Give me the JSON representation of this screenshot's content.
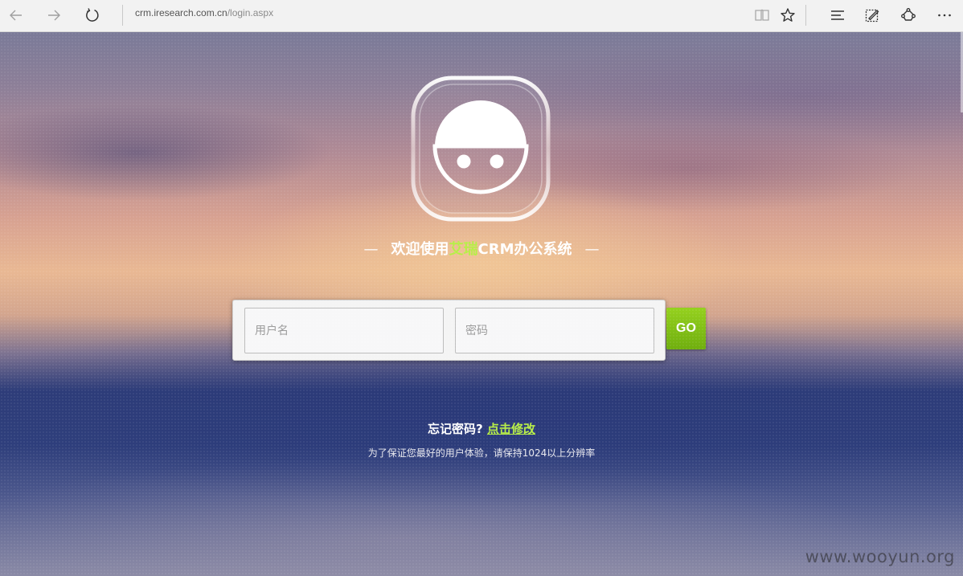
{
  "browser": {
    "address": {
      "domain": "crm.iresearch.com.cn",
      "path": "/login.aspx"
    },
    "icons": {
      "back": "back-arrow-icon",
      "forward": "forward-arrow-icon",
      "refresh": "refresh-icon",
      "reading_view": "reading-view-icon",
      "favorite": "star-icon",
      "hub": "hub-icon",
      "web_note": "web-note-icon",
      "share": "share-icon",
      "more": "more-icon"
    }
  },
  "login": {
    "welcome": {
      "dash": "—",
      "prefix": "欢迎使用",
      "brand": "艾瑞",
      "suffix": "CRM办公系统"
    },
    "username_placeholder": "用户名",
    "password_placeholder": "密码",
    "go_label": "GO",
    "forgot_text": "忘记密码?",
    "forgot_link": "点击修改",
    "resolution_note": "为了保证您最好的用户体验，请保持1024以上分辨率"
  },
  "watermark": "www.wooyun.org",
  "colors": {
    "accent_green": "#b7ee47",
    "go_button": "#7fbf14",
    "toolbar_bg": "#f2f2f2"
  }
}
